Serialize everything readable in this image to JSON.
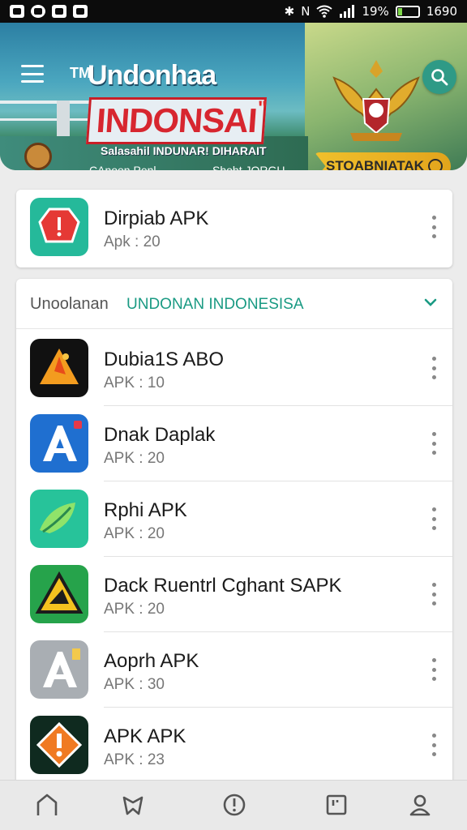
{
  "status_bar": {
    "battery_percent_text": "19%",
    "time": "1690",
    "left_icons": [
      "image-icon",
      "sync-icon",
      "camera-icon",
      "flag-icon"
    ],
    "right_icons": [
      "bluetooth-icon",
      "nfc-icon",
      "wifi-icon",
      "signal-icon",
      "battery-icon"
    ]
  },
  "banner": {
    "tm": "TM",
    "brand": "Undonhaa",
    "headline": "INDONSAI",
    "headline_quote": "\"",
    "subline": "Salasahil INDUNAR! DIHARAIT",
    "caption_left": "CAnoon Penl",
    "caption_right": "Shoht JORGU",
    "badge_label": "STOABNIATAK",
    "colors": {
      "headline_red": "#d7262f",
      "accent_teal": "#2f9a86",
      "badge_gold": "#f0c02c"
    }
  },
  "featured": {
    "title": "Dirpiab APK",
    "subtitle": "Apk : 20",
    "icon": "warning-stop-icon"
  },
  "section": {
    "label": "Unoolanan",
    "value": "UNDONAN INDONESISA"
  },
  "apps": [
    {
      "title": "Dubia1S ABO",
      "subtitle": "APK : 10",
      "icon": "flame-app-icon"
    },
    {
      "title": "Dnak Daplak",
      "subtitle": "APK : 20",
      "icon": "letter-a-app-icon"
    },
    {
      "title": "Rphi APK",
      "subtitle": "APK : 20",
      "icon": "leaf-app-icon"
    },
    {
      "title": "Dack Ruentrl  Cghant SAPK",
      "subtitle": "APK : 20",
      "icon": "triangle-app-icon"
    },
    {
      "title": "Aoprh APK",
      "subtitle": "APK : 30",
      "icon": "gray-a-app-icon"
    },
    {
      "title": "APK APK",
      "subtitle": "APK : 23",
      "icon": "alert-app-icon"
    }
  ],
  "bottom_nav": [
    "home-icon",
    "shield-icon",
    "info-icon",
    "bookmark-icon",
    "profile-icon"
  ]
}
